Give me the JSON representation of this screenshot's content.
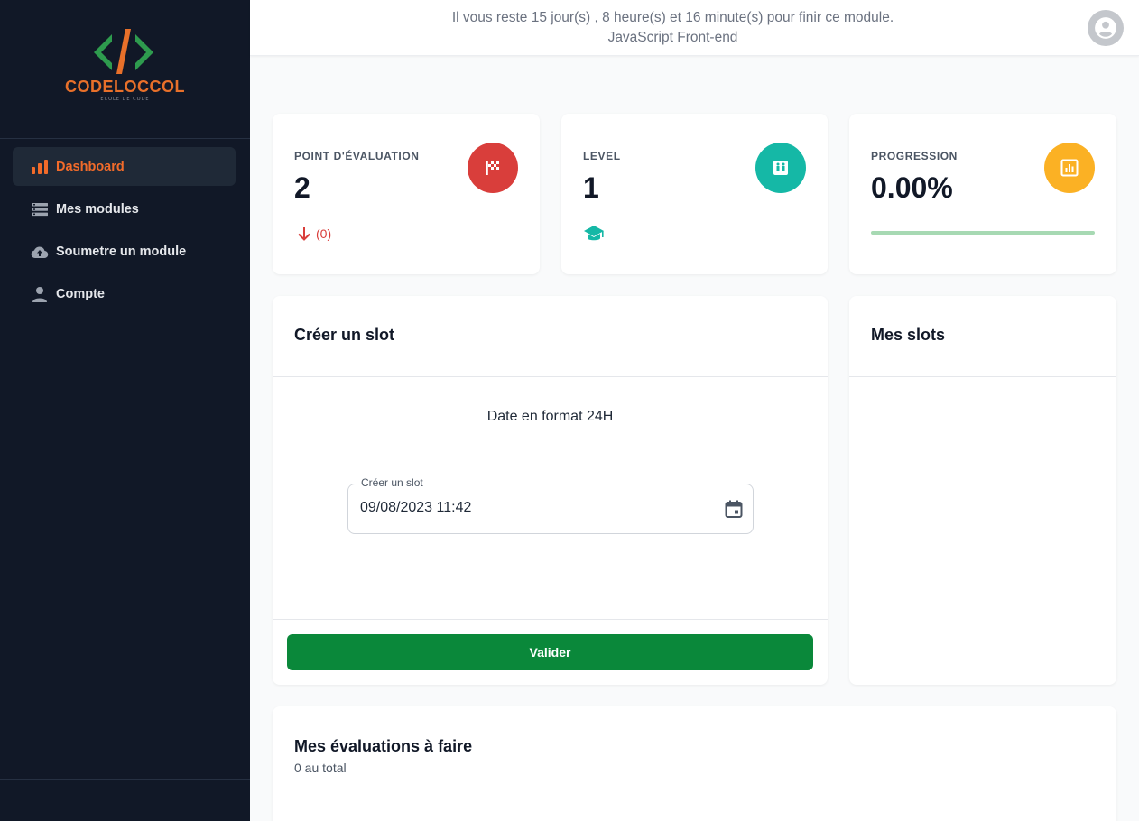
{
  "brand": {
    "name": "CODELOCCOL",
    "subtitle": "ECOLE DE CODE",
    "accent": "#e8702a"
  },
  "sidebar": {
    "items": [
      {
        "label": "Dashboard",
        "icon": "bar-chart-icon",
        "active": true
      },
      {
        "label": "Mes modules",
        "icon": "list-icon",
        "active": false
      },
      {
        "label": "Soumetre un module",
        "icon": "cloud-upload-icon",
        "active": false
      },
      {
        "label": "Compte",
        "icon": "user-icon",
        "active": false
      }
    ]
  },
  "header": {
    "countdown": "Il vous reste 15 jour(s) , 8 heure(s) et 16 minute(s) pour finir ce module.",
    "module": "JavaScript Front-end"
  },
  "stats": {
    "evaluation": {
      "label": "POINT D'ÉVALUATION",
      "value": "2",
      "delta": "(0)",
      "icon": "flag-icon",
      "color": "#d93e3b"
    },
    "level": {
      "label": "LEVEL",
      "value": "1",
      "icon": "elevator-icon",
      "color": "#15b8a6"
    },
    "progression": {
      "label": "PROGRESSION",
      "value": "0.00%",
      "progress": 0.0,
      "icon": "chart-icon",
      "color": "#fbb124"
    }
  },
  "create_slot": {
    "title": "Créer un slot",
    "hint": "Date en format 24H",
    "field_label": "Créer un slot",
    "field_value": "09/08/2023 11:42",
    "submit_label": "Valider"
  },
  "my_slots": {
    "title": "Mes slots"
  },
  "evaluations": {
    "title": "Mes évaluations à faire",
    "count": "0 au total"
  }
}
